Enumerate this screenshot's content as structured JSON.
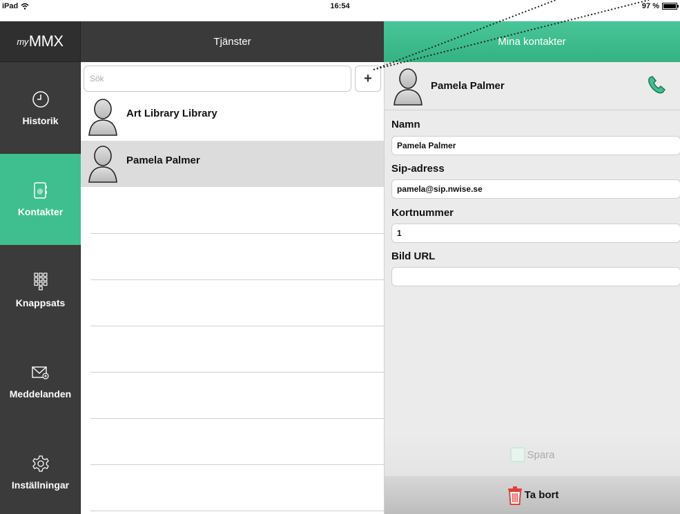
{
  "status_bar": {
    "device": "iPad",
    "time": "16:54",
    "battery": "97 %"
  },
  "sidebar": {
    "logo_prefix": "my",
    "logo_main": "MMX",
    "items": [
      {
        "label": "Historik",
        "icon": "clock-icon"
      },
      {
        "label": "Kontakter",
        "icon": "address-book-icon",
        "active": true
      },
      {
        "label": "Knappsats",
        "icon": "keypad-icon"
      },
      {
        "label": "Meddelanden",
        "icon": "envelope-icon"
      },
      {
        "label": "Inställningar",
        "icon": "gear-icon"
      }
    ]
  },
  "middle": {
    "title": "Tjänster",
    "search_placeholder": "Sök",
    "add_label": "+",
    "contacts": [
      {
        "name": "Art Library Library"
      },
      {
        "name": "Pamela Palmer",
        "selected": true
      }
    ]
  },
  "detail": {
    "title": "Mina kontakter",
    "contact_name": "Pamela Palmer",
    "fields": {
      "name_label": "Namn",
      "name_value": "Pamela Palmer",
      "sip_label": "Sip-adress",
      "sip_value": "pamela@sip.nwise.se",
      "short_label": "Kortnummer",
      "short_value": "1",
      "url_label": "Bild URL",
      "url_value": ""
    },
    "save_label": "Spara",
    "delete_label": "Ta bort"
  },
  "colors": {
    "accent": "#3fbf8f",
    "sidebar": "#3b3b3b",
    "header_dark": "#3a3a3a",
    "delete_icon": "#e0403a"
  }
}
